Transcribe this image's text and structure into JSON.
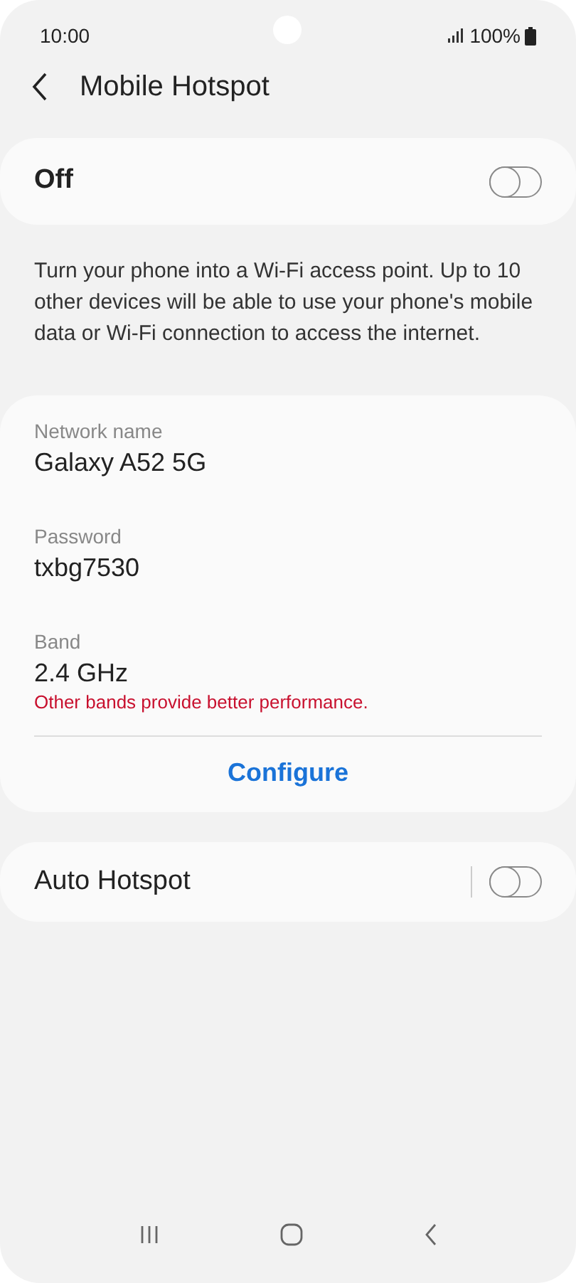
{
  "status_bar": {
    "time": "10:00",
    "battery": "100%"
  },
  "header": {
    "title": "Mobile Hotspot"
  },
  "main_switch": {
    "label": "Off",
    "on": false
  },
  "description": "Turn your phone into a Wi-Fi access point. Up to 10 other devices will be able to use your phone's mobile data or Wi-Fi connection to access the internet.",
  "settings": [
    {
      "label": "Network name",
      "value": "Galaxy A52 5G"
    },
    {
      "label": "Password",
      "value": "txbg7530"
    },
    {
      "label": "Band",
      "value": "2.4 GHz",
      "warning": "Other bands provide better performance."
    }
  ],
  "configure_button": "Configure",
  "auto_hotspot": {
    "label": "Auto Hotspot",
    "on": false
  }
}
